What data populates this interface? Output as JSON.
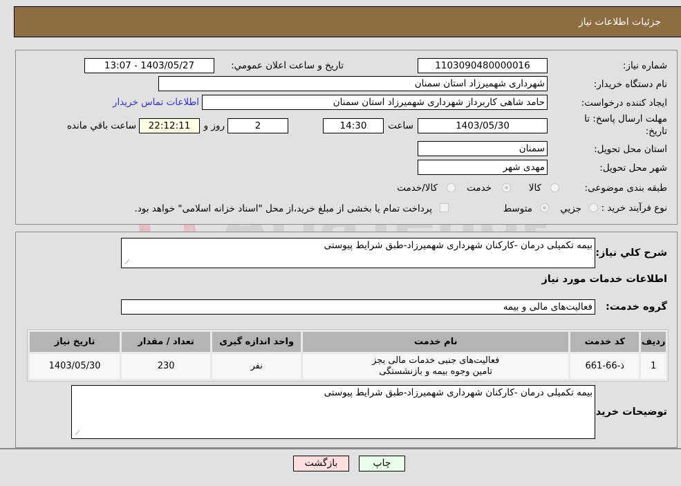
{
  "header": {
    "title": "جزئیات اطلاعات نیاز"
  },
  "details": {
    "need_number": {
      "label": "شماره نیاز:",
      "value": "1103090480000016"
    },
    "announce_datetime": {
      "label": "تاريخ و ساعت اعلان عمومي:",
      "value": "1403/05/27 - 13:07"
    },
    "buyer_org": {
      "label": "نام دستگاه خریدار:",
      "value": "شهرداری شهمیرزاد استان سمنان"
    },
    "requester": {
      "label": "ایجاد کننده درخواست:",
      "value": "حامد شاهی کاربرداز شهرداری شهمیرزاد استان سمنان"
    },
    "buyer_contact_link": "اطلاعات تماس خریدار",
    "deadline": {
      "label_line1": "مهلت ارسال پاسخ: تا",
      "label_line2": "تاریخ:",
      "date": "1403/05/30",
      "time_label": "ساعت",
      "time": "14:30",
      "days": "2",
      "days_label": "روز و",
      "remaining": "22:12:11",
      "remaining_label": "ساعت باقي مانده"
    },
    "delivery_province": {
      "label": "استان محل تحویل:",
      "value": "سمنان"
    },
    "delivery_city": {
      "label": "شهر محل تحویل:",
      "value": "مهدی شهر"
    },
    "category": {
      "label": "طبقه بندی موضوعی:",
      "options": [
        "کالا",
        "خدمت",
        "کالا/خدمت"
      ],
      "selected": "خدمت"
    },
    "purchase_type": {
      "label": "نوع فرآیند خرید :",
      "options": [
        "جزيي",
        "متوسط"
      ],
      "selected": "متوسط",
      "treasury_note": "پرداخت تمام یا بخشی از مبلغ خرید،از محل \"اسناد خزانه اسلامی\" خواهد بود."
    }
  },
  "description": {
    "label": "شرح كلي نياز:",
    "value": "بیمه تکمیلی درمان -کارکنان شهرداری شهمیرزاد-طبق شرایط پیوستی"
  },
  "services_section": {
    "title": "اطلاعات خدمات مورد نياز",
    "group_label": "گروه خدمت:",
    "group_value": "فعالیت‌های مالی و بیمه",
    "table": {
      "columns": [
        "ردیف",
        "کد خدمت",
        "نام خدمت",
        "واحد اندازه گیری",
        "تعداد / مقدار",
        "تاریخ نیاز"
      ],
      "rows": [
        {
          "row": "1",
          "code": "ذ-66-661",
          "name": "فعالیت‌های جنبی خدمات مالی بجز تامین وجوه بیمه و بازنشستگی",
          "unit": "نفر",
          "quantity": "230",
          "date": "1403/05/30"
        }
      ]
    }
  },
  "buyer_notes": {
    "label": "توضیحات خریدار:",
    "value": "بیمه تکمیلی درمان -کارکنان شهرداری شهمیرزاد-طبق شرایط پیوستی"
  },
  "buttons": {
    "print": "چاپ",
    "back": "بازگشت"
  },
  "watermark": {
    "text": "AriaTender.neT",
    "colors": {
      "logo": "#e8a0a0",
      "text": "#bdbdbd"
    }
  }
}
